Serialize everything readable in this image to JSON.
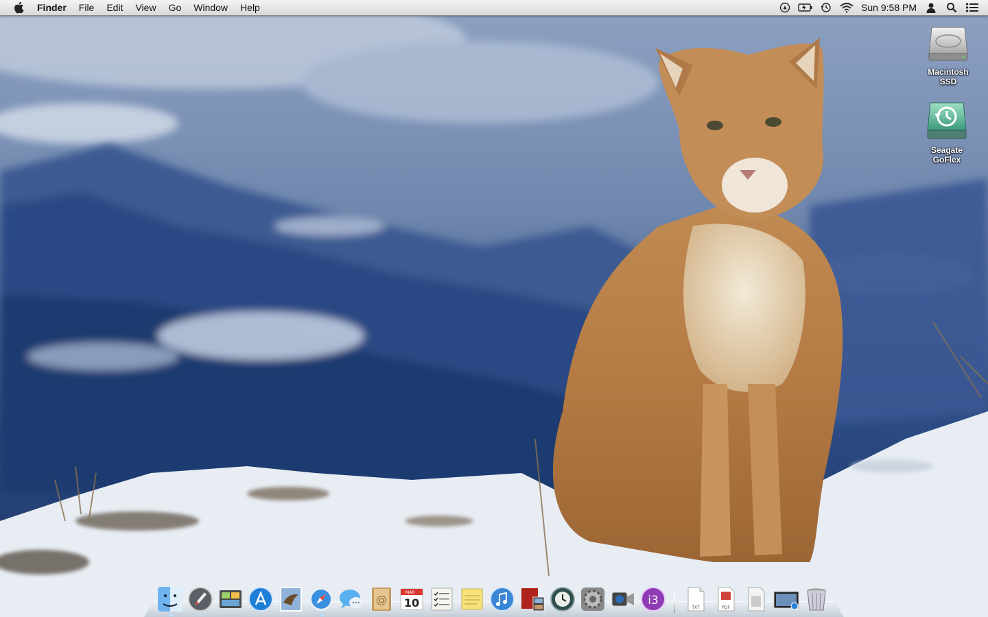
{
  "menubar": {
    "app_name": "Finder",
    "items": [
      "File",
      "Edit",
      "View",
      "Go",
      "Window",
      "Help"
    ],
    "clock": "Sun 9:58 PM",
    "status_icons": [
      "airplay-icon",
      "battery-icon",
      "time-machine-icon",
      "wifi-icon",
      "user-icon",
      "spotlight-icon",
      "notification-center-icon"
    ]
  },
  "desktop": {
    "icons": [
      {
        "label": "Macintosh\nSSD",
        "icon": "hard-drive-icon"
      },
      {
        "label": "Seagate\nGoFlex",
        "icon": "time-machine-drive-icon"
      }
    ]
  },
  "dock": {
    "apps": [
      "finder-icon",
      "launchpad-icon",
      "image-capture-icon",
      "app-store-icon",
      "mail-icon",
      "safari-icon",
      "messages-icon",
      "contacts-icon",
      "calendar-icon",
      "reminders-icon",
      "notes-icon",
      "itunes-icon",
      "photo-booth-icon",
      "time-machine-icon",
      "system-preferences-icon",
      "facetime-icon",
      "ibooks-icon"
    ],
    "calendar": {
      "month": "MAR",
      "day": "10"
    },
    "stacks": [
      "txt-document-icon",
      "pdf-document-icon",
      "document-icon",
      "screenshot-icon",
      "trash-icon"
    ],
    "stack_labels": {
      "txt": "TXT",
      "pdf": "PDF"
    }
  }
}
